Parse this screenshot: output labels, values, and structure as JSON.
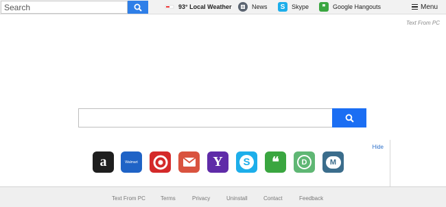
{
  "header": {
    "search_placeholder": "Search",
    "weather": "93° Local Weather",
    "news": "News",
    "skype": "Skype",
    "hangouts": "Google Hangouts",
    "menu": "Menu"
  },
  "brand": "Text From PC",
  "main_search": {
    "value": ""
  },
  "apps": {
    "hide_label": "Hide",
    "items": [
      {
        "name": "amazon",
        "glyph": "a",
        "color": "#1e1e1e"
      },
      {
        "name": "walmart",
        "glyph": "Walmart",
        "color": "#1f63c6"
      },
      {
        "name": "target",
        "glyph": "",
        "color": "#d42a2a"
      },
      {
        "name": "gmail",
        "glyph": "",
        "color": "#d9533f"
      },
      {
        "name": "yahoo",
        "glyph": "Y",
        "color": "#5f2ba8"
      },
      {
        "name": "skype",
        "glyph": "S",
        "color": "#1daeea"
      },
      {
        "name": "hangouts",
        "glyph": "❝",
        "color": "#3aa640"
      },
      {
        "name": "pushbullet",
        "glyph": "D",
        "color": "#5fb774"
      },
      {
        "name": "textfrompc",
        "glyph": "M",
        "color": "#3b6d8c"
      }
    ]
  },
  "footer": {
    "links": [
      "Text From PC",
      "Terms",
      "Privacy",
      "Uninstall",
      "Contact",
      "Feedback"
    ]
  },
  "colors": {
    "accent": "#1b6ef3",
    "top_button": "#2f7fe8"
  }
}
